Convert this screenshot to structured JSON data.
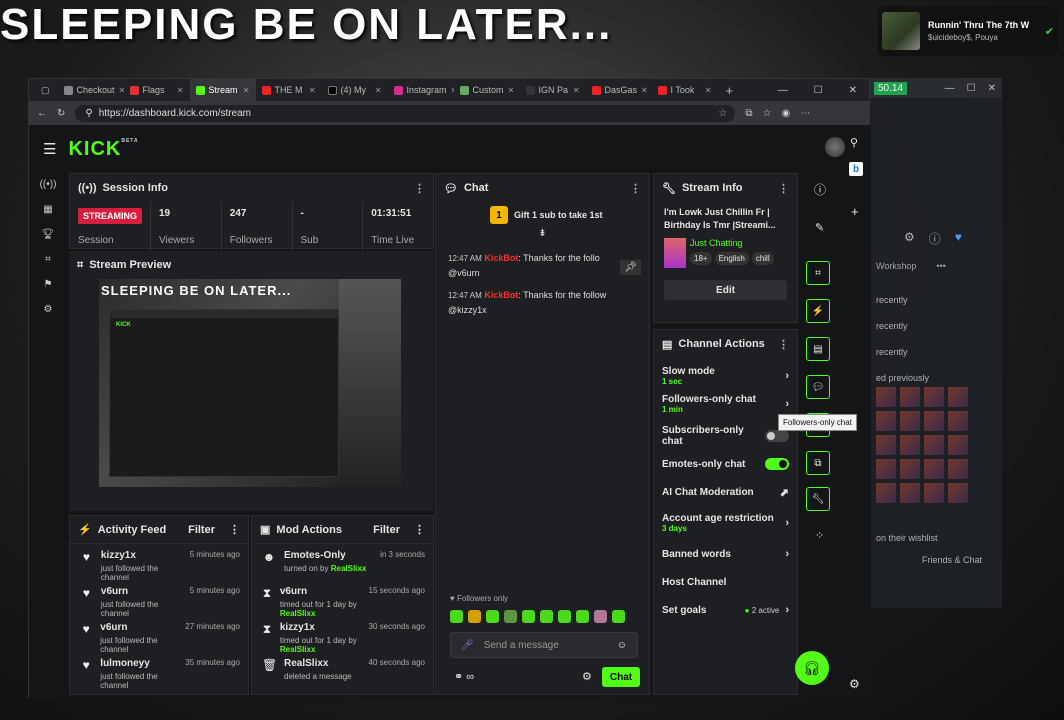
{
  "overlay": {
    "title": "SLEEPING BE ON LATER..."
  },
  "now_playing": {
    "song": "Runnin' Thru The 7th W",
    "artist": "$uicideboy$, Pouya"
  },
  "bg_window": {
    "price": "50.14",
    "tab": "Workshop",
    "items": [
      "recently",
      "recently",
      "recently",
      "ed previously"
    ],
    "wishlist": "on their wishlist",
    "friends": "Friends & Chat"
  },
  "browser": {
    "tabs": [
      "Checkout",
      "Flags",
      "Stream",
      "THE M",
      "(4) My",
      "Instagram",
      "Custom",
      "IGN Pa",
      "DasGas",
      "I Took"
    ],
    "url": "https://dashboard.kick.com/stream"
  },
  "app": {
    "logo": "KICK",
    "beta": "BETA"
  },
  "session": {
    "title": "Session Info",
    "status": "STREAMING",
    "status_label": "Session",
    "viewers": "19",
    "viewers_label": "Viewers",
    "followers": "247",
    "followers_label": "Followers",
    "sub": "-",
    "sub_label": "Sub",
    "time": "01:31:51",
    "time_label": "Time Live"
  },
  "preview": {
    "title": "Stream Preview",
    "overlay": "SLEEPING BE ON LATER..."
  },
  "activity": {
    "title": "Activity Feed",
    "filter": "Filter",
    "rows": [
      {
        "name": "kizzy1x",
        "sub": "just followed the channel",
        "time": "5 minutes ago"
      },
      {
        "name": "v6urn",
        "sub": "just followed the channel",
        "time": "5 minutes ago"
      },
      {
        "name": "v6urn",
        "sub": "just followed the channel",
        "time": "27 minutes ago"
      },
      {
        "name": "lulmoneyy",
        "sub": "just followed the channel",
        "time": "35 minutes ago"
      }
    ]
  },
  "mod": {
    "title": "Mod Actions",
    "filter": "Filter",
    "rows": [
      {
        "name": "Emotes-Only",
        "sub": "turned on by",
        "who": "RealSlixx",
        "time": "in 3 seconds"
      },
      {
        "name": "v6urn",
        "sub": "timed out for 1 day by",
        "who": "RealSlixx",
        "time": "15 seconds ago"
      },
      {
        "name": "kizzy1x",
        "sub": "timed out for 1 day by",
        "who": "RealSlixx",
        "time": "30 seconds ago"
      },
      {
        "name": "RealSlixx",
        "sub": "deleted a message",
        "who": "",
        "time": "40 seconds ago"
      }
    ]
  },
  "chat": {
    "title": "Chat",
    "gift": "Gift 1 sub to take 1st",
    "gift_num": "1",
    "messages": [
      {
        "time": "12:47 AM",
        "user": "KickBot",
        "text": ": Thanks for the follo",
        "mention": "@v6urn"
      },
      {
        "time": "12:47 AM",
        "user": "KickBot",
        "text": ": Thanks for the follow",
        "mention": "@kizzy1x"
      }
    ],
    "followers_only": "Followers only",
    "placeholder": "Send a message",
    "send": "Chat"
  },
  "stream_info": {
    "title": "Stream Info",
    "stream_title": "I'm Lowk Just Chillin Fr | Birthday Is Tmr |Streami...",
    "category": "Just Chatting",
    "tags": [
      "18+",
      "English",
      "chill"
    ],
    "edit": "Edit"
  },
  "channel_actions": {
    "title": "Channel Actions",
    "rows": [
      {
        "label": "Slow mode",
        "sub": "1 sec"
      },
      {
        "label": "Followers-only chat",
        "sub": "1 min"
      },
      {
        "label": "Subscribers-only chat",
        "sub": ""
      },
      {
        "label": "Emotes-only chat",
        "sub": ""
      },
      {
        "label": "AI Chat Moderation",
        "sub": ""
      },
      {
        "label": "Account age restriction",
        "sub": "3 days"
      },
      {
        "label": "Banned words",
        "sub": ""
      },
      {
        "label": "Host Channel",
        "sub": ""
      },
      {
        "label": "Set goals",
        "sub": "",
        "extra": "2 active"
      }
    ]
  },
  "tooltip": "Followers-only chat",
  "colors": {
    "accent": "#53fc18",
    "live": "#d81e3f"
  }
}
